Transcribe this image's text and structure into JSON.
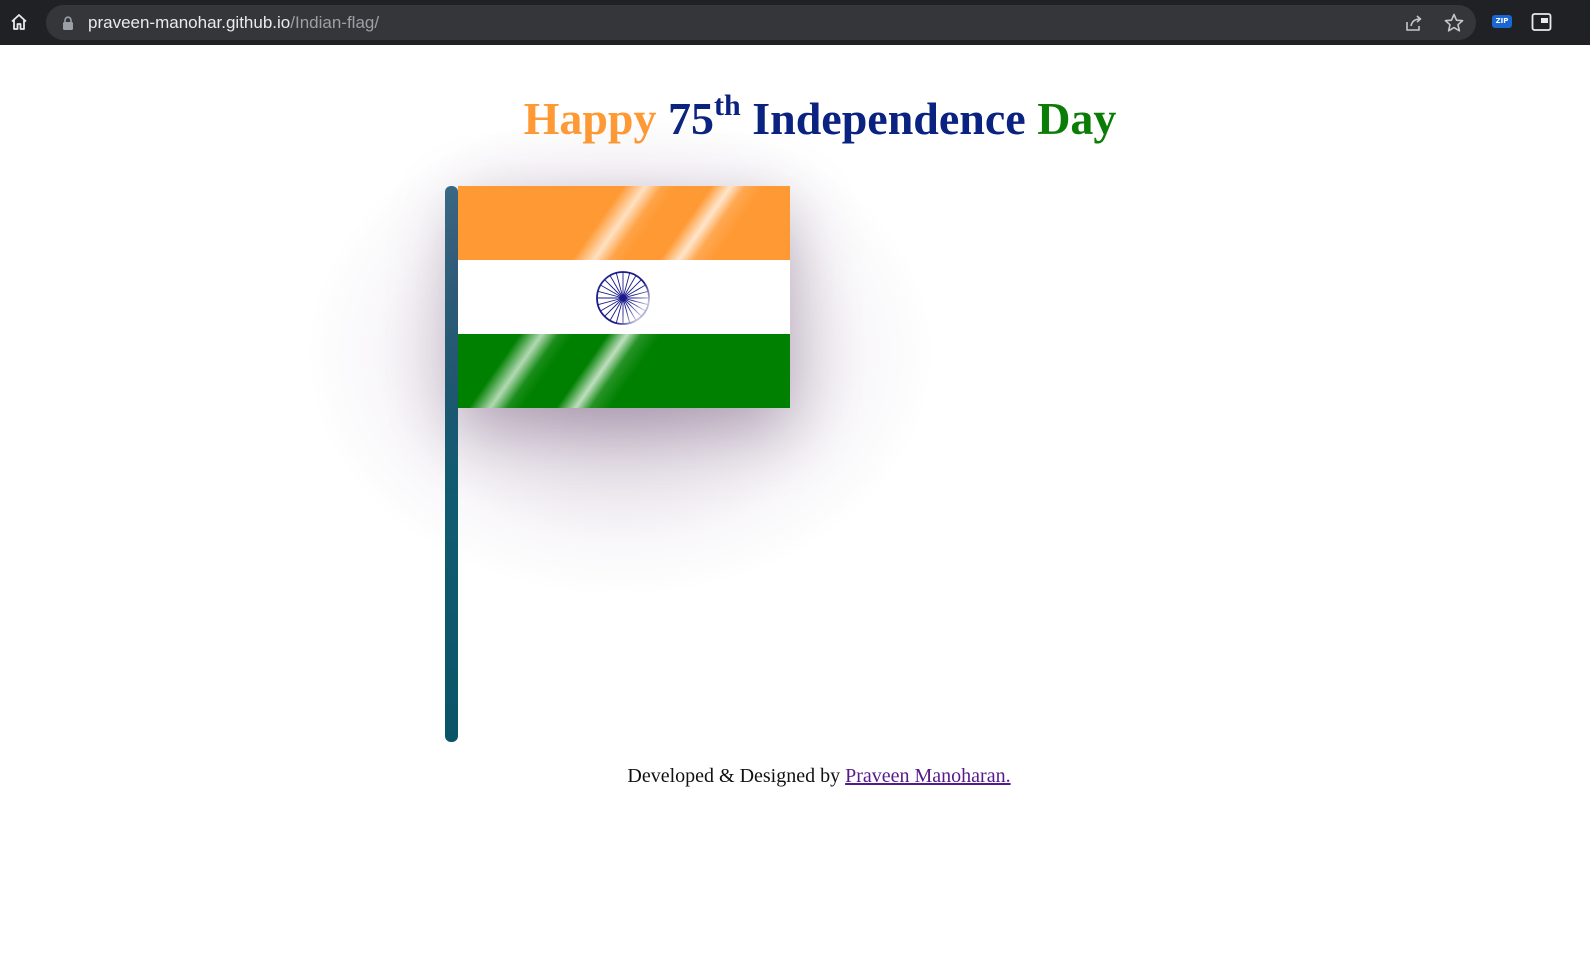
{
  "browser": {
    "url_host": "praveen-manohar.github.io",
    "url_path": "/Indian-flag/",
    "extension_badge": "ZIP",
    "icons": {
      "home": "home-icon",
      "lock": "lock-icon",
      "share": "share-icon",
      "bookmark": "star-icon",
      "extension": "zip-extension-icon",
      "side_panel": "picture-in-picture-icon"
    }
  },
  "page": {
    "heading": {
      "word_happy": "Happy",
      "number": "75",
      "superscript": "th",
      "word_independence": "Independence",
      "word_day": "Day"
    },
    "footer": {
      "text": "Developed & Designed by",
      "author_link": "Praveen Manoharan."
    }
  },
  "colors": {
    "saffron": "#ff9933",
    "white": "#ffffff",
    "green": "#008000",
    "navy": "#0a2280",
    "chakra": "#1a1a8a",
    "pole": "#0b5468"
  }
}
